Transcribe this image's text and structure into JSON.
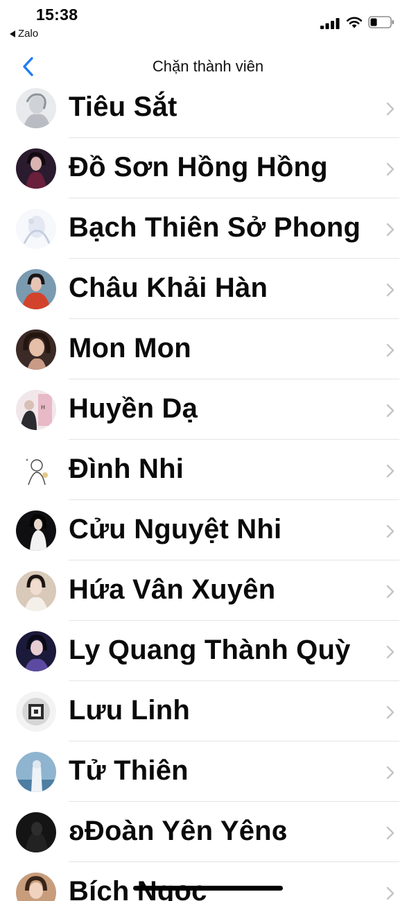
{
  "status_bar": {
    "time": "15:38",
    "back_app": "Zalo"
  },
  "nav": {
    "title": "Chặn thành viên"
  },
  "colors": {
    "accent": "#1e7cf2",
    "chevron": "#c4c4c8",
    "divider": "#e4e4e6"
  },
  "members": [
    {
      "name": "Tiêu Sắt",
      "avatar": "avatar-icon"
    },
    {
      "name": "Đồ Sơn Hồng Hồng",
      "avatar": "avatar-icon"
    },
    {
      "name": "Bạch Thiên Sở Phong",
      "avatar": "avatar-icon"
    },
    {
      "name": "Châu Khải Hàn",
      "avatar": "avatar-icon"
    },
    {
      "name": "Mon Mon",
      "avatar": "avatar-icon"
    },
    {
      "name": "Huyền Dạ",
      "avatar": "avatar-icon"
    },
    {
      "name": "Đình Nhi",
      "avatar": "avatar-icon"
    },
    {
      "name": "Cửu Nguyệt Nhi",
      "avatar": "avatar-icon"
    },
    {
      "name": "Hứa Vân Xuyên",
      "avatar": "avatar-icon"
    },
    {
      "name": "Ly Quang Thành Quỳ",
      "avatar": "avatar-icon"
    },
    {
      "name": "Lưu Linh",
      "avatar": "avatar-icon"
    },
    {
      "name": "Tử Thiên",
      "avatar": "avatar-icon"
    },
    {
      "name": "ʚĐoàn Yên Yênɞ",
      "avatar": "avatar-icon"
    },
    {
      "name": "Bích Ngọc",
      "avatar": "avatar-icon"
    }
  ]
}
